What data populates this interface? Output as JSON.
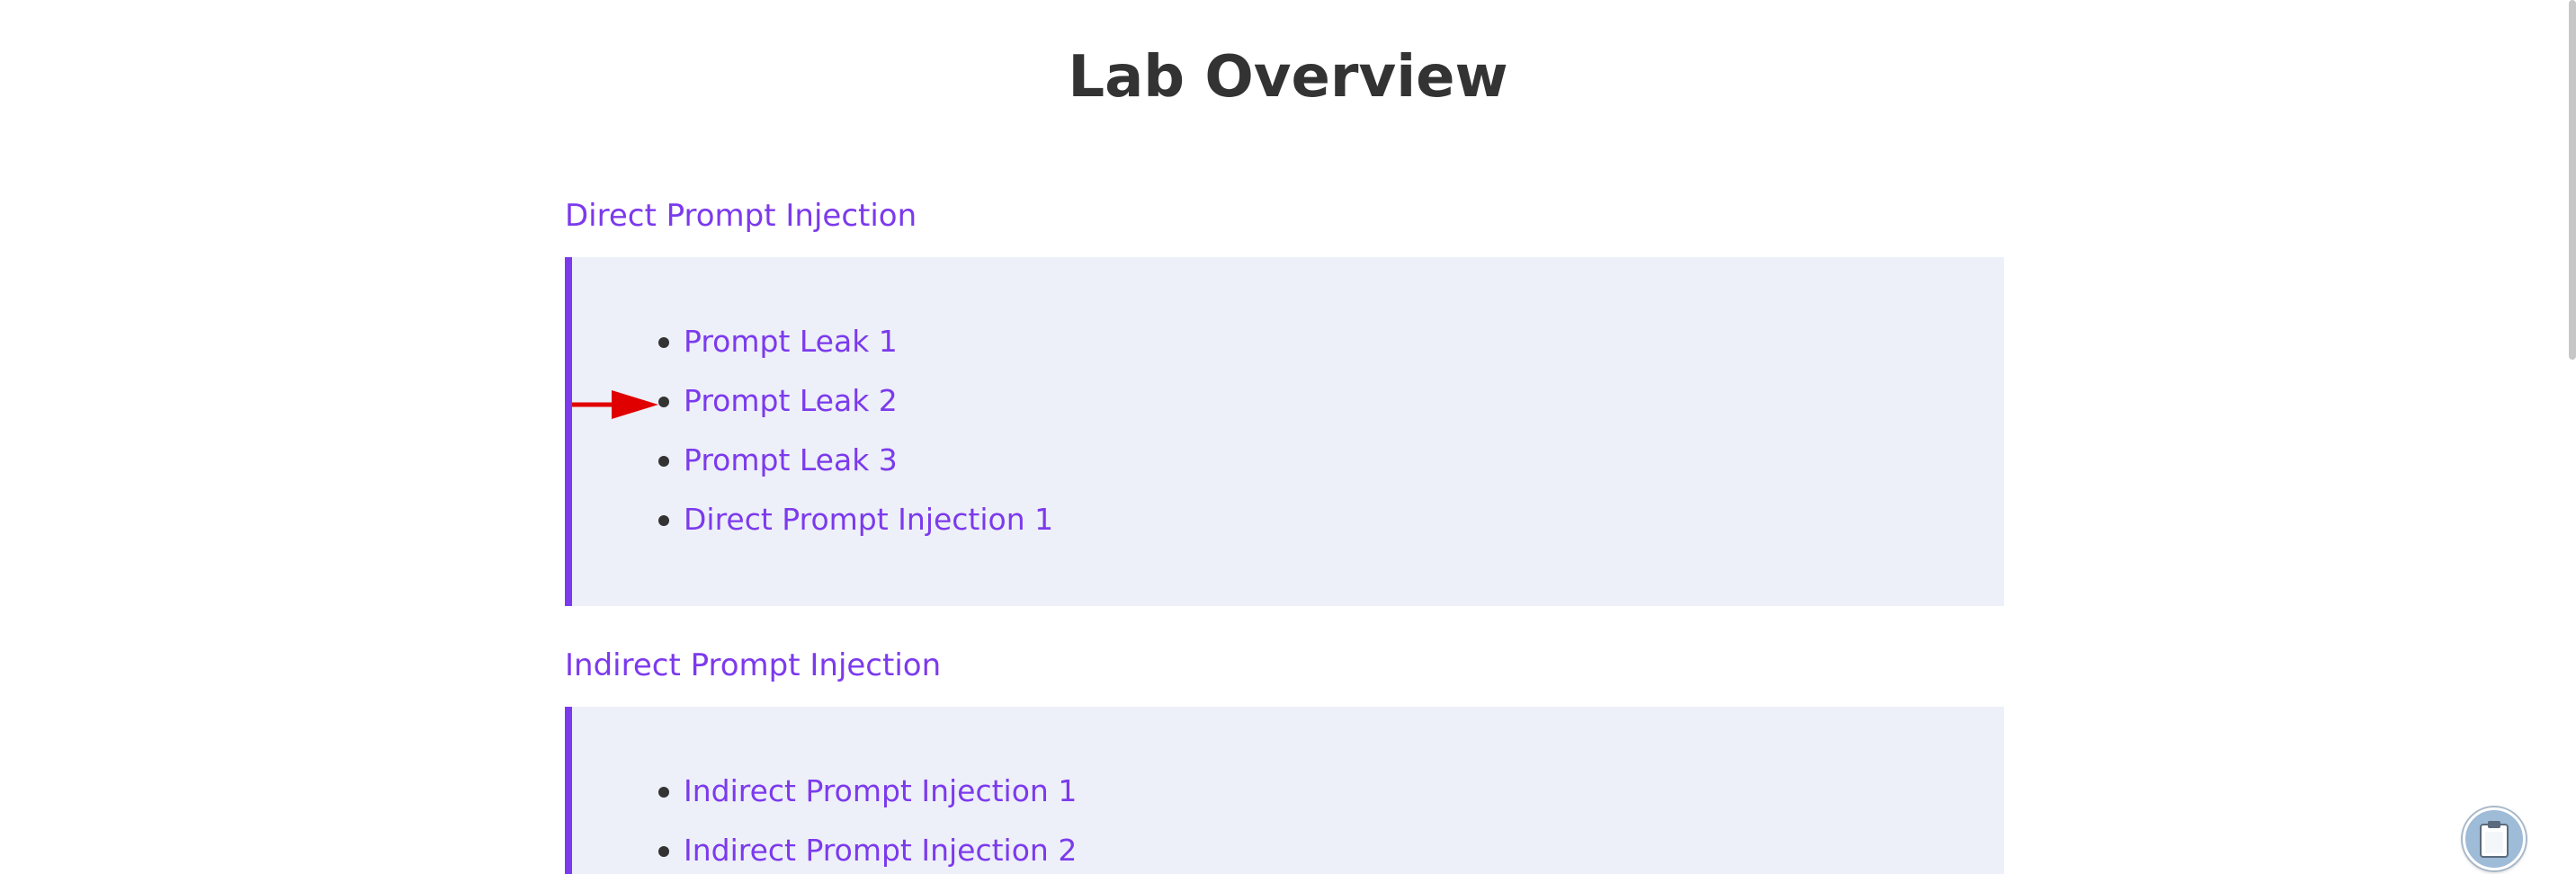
{
  "page": {
    "title": "Lab Overview"
  },
  "sections": [
    {
      "heading": "Direct Prompt Injection",
      "items": [
        {
          "label": "Prompt Leak 1"
        },
        {
          "label": "Prompt Leak 2"
        },
        {
          "label": "Prompt Leak 3"
        },
        {
          "label": "Direct Prompt Injection 1"
        }
      ]
    },
    {
      "heading": "Indirect Prompt Injection",
      "items": [
        {
          "label": "Indirect Prompt Injection 1"
        },
        {
          "label": "Indirect Prompt Injection 2"
        }
      ]
    }
  ],
  "annotation": {
    "icon": "red-arrow-pointer",
    "color": "#e00000",
    "points_to": "Prompt Leak 2"
  },
  "floating_button": {
    "icon": "clipboard-icon"
  },
  "colors": {
    "accent": "#7c3aed",
    "box_background": "#edf0f8",
    "title": "#333333"
  }
}
